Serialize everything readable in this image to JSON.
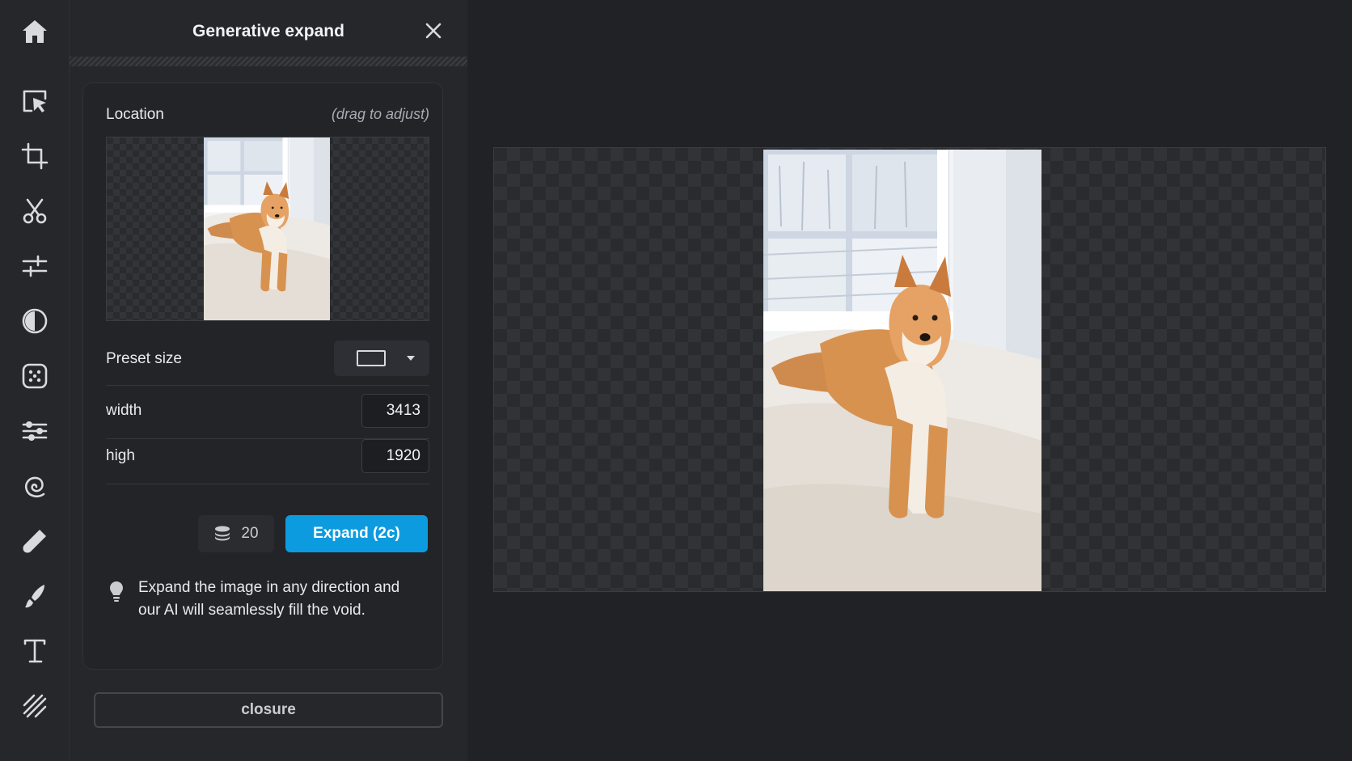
{
  "panel": {
    "title": "Generative expand",
    "location_label": "Location",
    "location_hint": "(drag to adjust)",
    "preset_label": "Preset size",
    "width_label": "width",
    "width_value": "3413",
    "height_label": "high",
    "height_value": "1920",
    "credits_value": "20",
    "expand_label": "Expand (2c)",
    "tip_text": "Expand the image in any direction and our AI will seamlessly fill the void.",
    "close_label": "closure"
  },
  "toolbar": {
    "items": [
      "home-icon",
      "select-icon",
      "crop-icon",
      "cut-icon",
      "adjust-icon",
      "contrast-icon",
      "filter-icon",
      "effects-icon",
      "liquify-icon",
      "retouch-icon",
      "paint-icon",
      "text-icon",
      "pattern-icon"
    ]
  },
  "colors": {
    "accent": "#0d9be0",
    "panel_bg": "#25272b",
    "canvas_bg": "#202226"
  }
}
